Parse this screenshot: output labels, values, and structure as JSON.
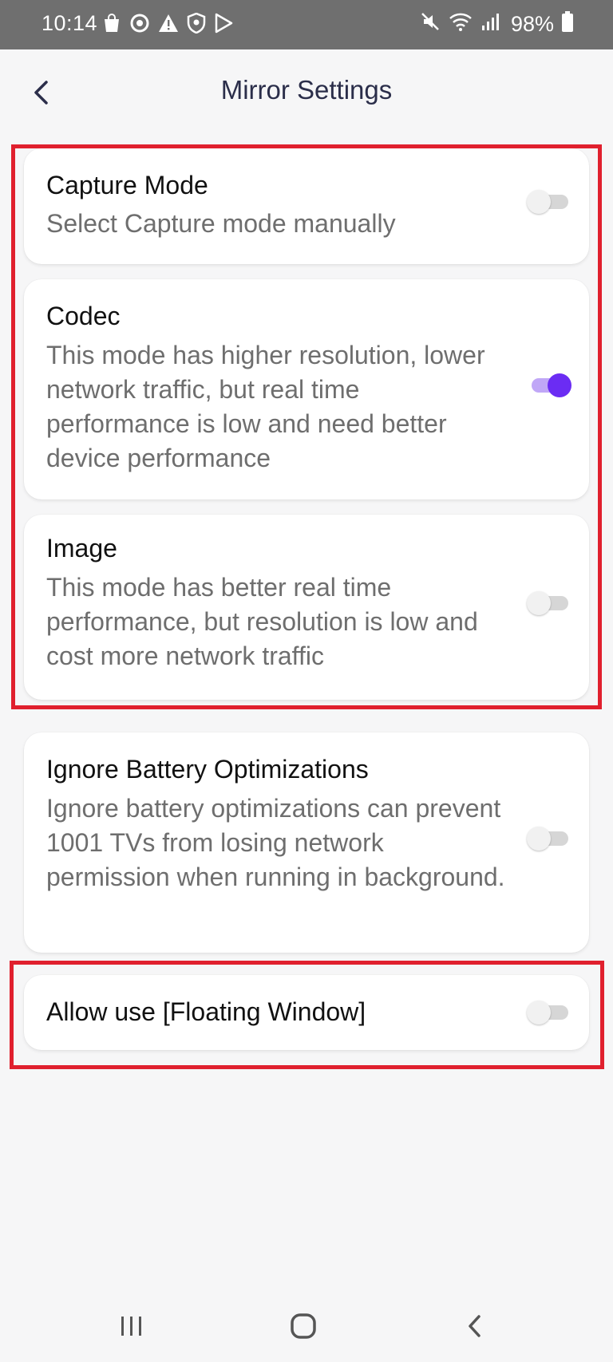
{
  "status_bar": {
    "time": "10:14",
    "battery_percent": "98%",
    "left_icons": [
      "shopping-bag-icon",
      "sync-icon",
      "warning-icon",
      "shield-icon",
      "play-store-icon"
    ],
    "right_icons": [
      "mute-icon",
      "wifi-icon",
      "signal-icon",
      "battery-icon"
    ]
  },
  "header": {
    "title": "Mirror Settings",
    "back_icon": "chevron-left-icon"
  },
  "settings": [
    {
      "title": "Capture Mode",
      "description": "Select Capture mode manually",
      "enabled": false
    },
    {
      "title": "Codec",
      "description": "This mode has higher resolution, lower network traffic, but real time performance is low and need better device performance",
      "enabled": true
    },
    {
      "title": "Image",
      "description": "This mode has better real time performance, but resolution is low and cost more network traffic",
      "enabled": false
    },
    {
      "title": "Ignore Battery Optimizations",
      "description": "Ignore battery optimizations can prevent 1001 TVs from losing network permission when running in background.",
      "enabled": false
    },
    {
      "title": "Allow use [Floating Window]",
      "enabled": false
    }
  ],
  "colors": {
    "accent": "#6b2cf3",
    "accent_track": "#c0a7f7",
    "highlight": "#e0202e",
    "status_bar": "#6f6f6f"
  },
  "nav_bar": {
    "icons": [
      "recent-apps-icon",
      "home-icon",
      "back-icon"
    ]
  }
}
